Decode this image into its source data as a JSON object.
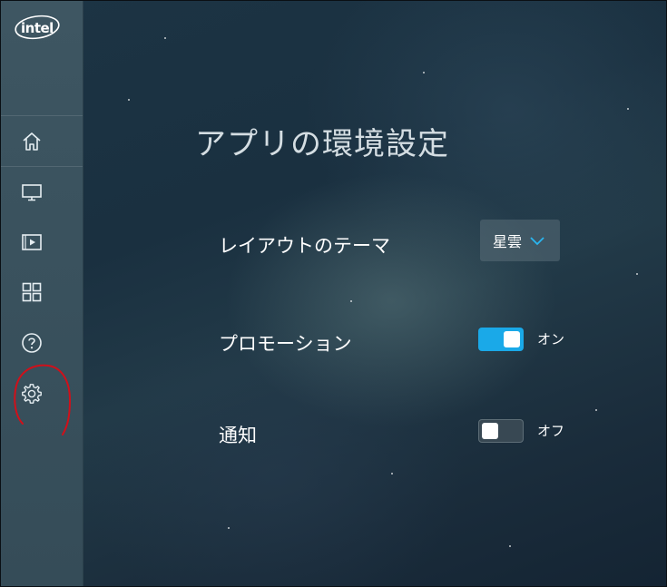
{
  "brand": {
    "logo_text": "intel"
  },
  "sidebar": {
    "items": [
      {
        "icon": "home-icon"
      },
      {
        "icon": "monitor-icon"
      },
      {
        "icon": "media-icon"
      },
      {
        "icon": "apps-grid-icon"
      },
      {
        "icon": "help-icon"
      },
      {
        "icon": "gear-icon"
      }
    ],
    "annotation": "red hand-drawn circle around settings gear icon"
  },
  "main": {
    "title": "アプリの環境設定",
    "settings": {
      "theme": {
        "label": "レイアウトのテーマ",
        "value": "星雲"
      },
      "promotion": {
        "label": "プロモーション",
        "state_text": "オン",
        "enabled": true
      },
      "notification": {
        "label": "通知",
        "state_text": "オフ",
        "enabled": false
      }
    }
  },
  "colors": {
    "toggle_on": "#1aa9e8",
    "sidebar": "#3a525e",
    "annotation": "#d0101a"
  }
}
